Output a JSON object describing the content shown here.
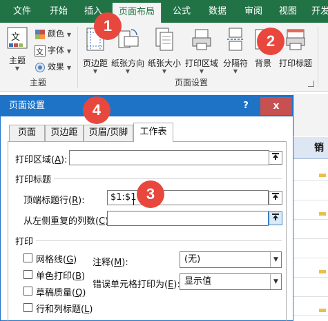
{
  "ribbon_tabs": [
    "文件",
    "开始",
    "插入",
    "页面布局",
    "公式",
    "数据",
    "审阅",
    "视图",
    "开发"
  ],
  "active_tab": "页面布局",
  "ribbon": {
    "theme_group": {
      "themes_label": "主题",
      "colors_label": "颜色",
      "fonts_label": "字体",
      "effects_label": "效果",
      "caption": "主题"
    },
    "page_setup_group": {
      "margins_label": "页边距",
      "orientation_label": "纸张方向",
      "size_label": "纸张大小",
      "print_area_label": "打印区域",
      "breaks_label": "分隔符",
      "background_label": "背景",
      "print_titles_label": "打印标题",
      "caption": "页面设置"
    }
  },
  "dialog": {
    "title": "页面设置",
    "help": "?",
    "close": "x",
    "tabs": [
      "页面",
      "页边距",
      "页眉/页脚",
      "工作表"
    ],
    "active_tab": "工作表",
    "print_area": {
      "label": "打印区域(",
      "key": "A",
      "suffix": "):",
      "value": ""
    },
    "print_titles_section": "打印标题",
    "rows_to_repeat": {
      "label": "顶端标题行(",
      "key": "R",
      "suffix": "):",
      "value": "$1:$1"
    },
    "cols_to_repeat": {
      "label": "从左侧重复的列数(",
      "key": "C",
      "suffix": "):",
      "value": ""
    },
    "print_section": "打印",
    "gridlines": {
      "label": "网格线(",
      "key": "G",
      "suffix": ")",
      "checked": false
    },
    "black_white": {
      "label": "单色打印(",
      "key": "B",
      "suffix": ")",
      "checked": false
    },
    "draft_quality": {
      "label": "草稿质量(",
      "key": "Q",
      "suffix": ")",
      "checked": false
    },
    "row_col_headings": {
      "label": "行和列标题(",
      "key": "L",
      "suffix": ")",
      "checked": false
    },
    "comments": {
      "label": "注释(",
      "key": "M",
      "suffix": "):",
      "value": "(无)"
    },
    "cell_errors": {
      "label": "错误单元格打印为(",
      "key": "E",
      "suffix": "):",
      "value": "显示值"
    }
  },
  "sheet": {
    "header_cell": "销"
  },
  "callouts": [
    "1",
    "2",
    "3",
    "4"
  ],
  "colors": {
    "excel_green": "#217346",
    "dialog_blue": "#1e73c7",
    "callout_red": "#e8473e",
    "close_red": "#c75050"
  }
}
